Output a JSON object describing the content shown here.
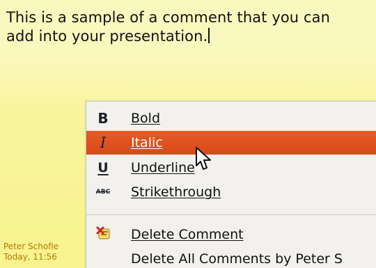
{
  "comment": {
    "text_line_1": "This is a sample of a comment that you can",
    "text_line_2": "add into your presentation.",
    "author": "Peter Schofie",
    "timestamp": "Today, 11:56"
  },
  "context_menu": {
    "items": [
      {
        "label": "Bold",
        "icon": "bold-icon",
        "state": "normal"
      },
      {
        "label": "Italic",
        "icon": "italic-icon",
        "state": "hovered"
      },
      {
        "label": "Underline",
        "icon": "underline-icon",
        "state": "normal"
      },
      {
        "label": "Strikethrough",
        "icon": "strikethrough-icon",
        "state": "normal"
      },
      {
        "label": "Delete Comment",
        "icon": "delete-comment-icon",
        "state": "normal"
      },
      {
        "label": "Delete All Comments by Peter S",
        "icon": "",
        "state": "normal"
      }
    ],
    "icon_glyphs": {
      "bold": "B",
      "italic": "I",
      "underline": "U",
      "strikethrough": "ABC"
    },
    "highlight_color": "#e1531f"
  },
  "colors": {
    "comment_background": "#f7f38f",
    "author_text": "#b87900",
    "menu_background": "#f2f1ee"
  }
}
